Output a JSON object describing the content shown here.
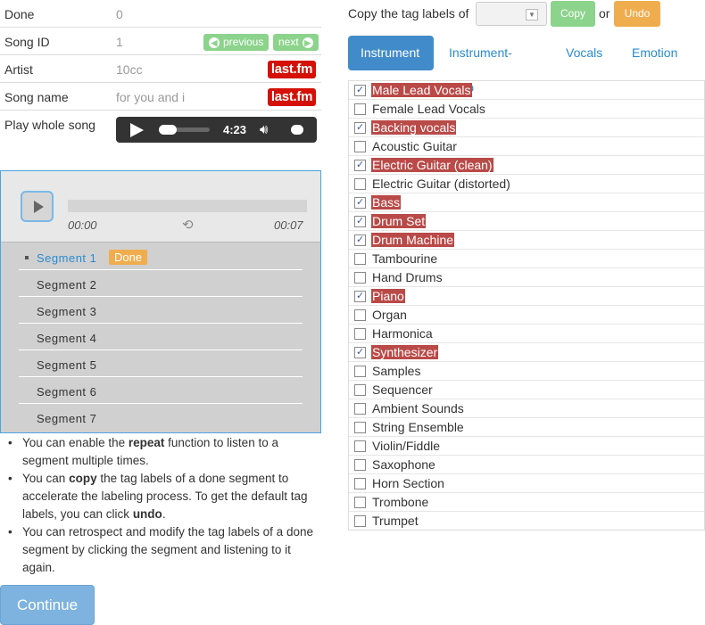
{
  "info": {
    "done_label": "Done",
    "done_value": "0",
    "song_id_label": "Song ID",
    "song_id_value": "1",
    "prev_label": "previous",
    "next_label": "next",
    "artist_label": "Artist",
    "artist_value": "10cc",
    "song_name_label": "Song name",
    "song_name_value": "for you and i",
    "lastfm_label": "last.fm",
    "play_label": "Play whole song",
    "player_time": "4:23"
  },
  "segment_player": {
    "time_start": "00:00",
    "time_end": "00:07",
    "segments": [
      {
        "label": "Segment 1",
        "active": true,
        "badge": "Done"
      },
      {
        "label": "Segment 2"
      },
      {
        "label": "Segment 3"
      },
      {
        "label": "Segment 4"
      },
      {
        "label": "Segment 5"
      },
      {
        "label": "Segment 6"
      },
      {
        "label": "Segment 7"
      }
    ]
  },
  "help": [
    {
      "pre": "You can enable the ",
      "bold": "repeat",
      "post": " function to listen to a segment multiple times."
    },
    {
      "pre": "You can ",
      "bold": "copy",
      "post": " the tag labels of a done segment to accelerate the labeling process. To get the default tag labels, you can click ",
      "bold2": "undo",
      "post2": "."
    },
    {
      "pre": "You can retrospect and modify the tag labels of a done segment by clicking the segment and listening to it again."
    }
  ],
  "continue_label": "Continue",
  "copy_bar": {
    "text": "Copy the tag labels of",
    "copy_label": "Copy",
    "or_text": "or",
    "undo_label": "Undo"
  },
  "tabs": [
    {
      "label": "Instrument",
      "active": true
    },
    {
      "label": "Instrument-Solo"
    },
    {
      "label": "Vocals"
    },
    {
      "label": "Emotion"
    }
  ],
  "tags": [
    {
      "label": "Male Lead Vocals",
      "checked": true
    },
    {
      "label": "Female Lead Vocals",
      "checked": false
    },
    {
      "label": "Backing vocals",
      "checked": true
    },
    {
      "label": "Acoustic Guitar",
      "checked": false
    },
    {
      "label": "Electric Guitar (clean)",
      "checked": true
    },
    {
      "label": "Electric Guitar (distorted)",
      "checked": false
    },
    {
      "label": "Bass",
      "checked": true
    },
    {
      "label": "Drum Set",
      "checked": true
    },
    {
      "label": "Drum Machine",
      "checked": true
    },
    {
      "label": "Tambourine",
      "checked": false
    },
    {
      "label": "Hand Drums",
      "checked": false
    },
    {
      "label": "Piano",
      "checked": true
    },
    {
      "label": "Organ",
      "checked": false
    },
    {
      "label": "Harmonica",
      "checked": false
    },
    {
      "label": "Synthesizer",
      "checked": true
    },
    {
      "label": "Samples",
      "checked": false
    },
    {
      "label": "Sequencer",
      "checked": false
    },
    {
      "label": "Ambient Sounds",
      "checked": false
    },
    {
      "label": "String Ensemble",
      "checked": false
    },
    {
      "label": "Violin/Fiddle",
      "checked": false
    },
    {
      "label": "Saxophone",
      "checked": false
    },
    {
      "label": "Horn Section",
      "checked": false
    },
    {
      "label": "Trombone",
      "checked": false
    },
    {
      "label": "Trumpet",
      "checked": false
    }
  ]
}
